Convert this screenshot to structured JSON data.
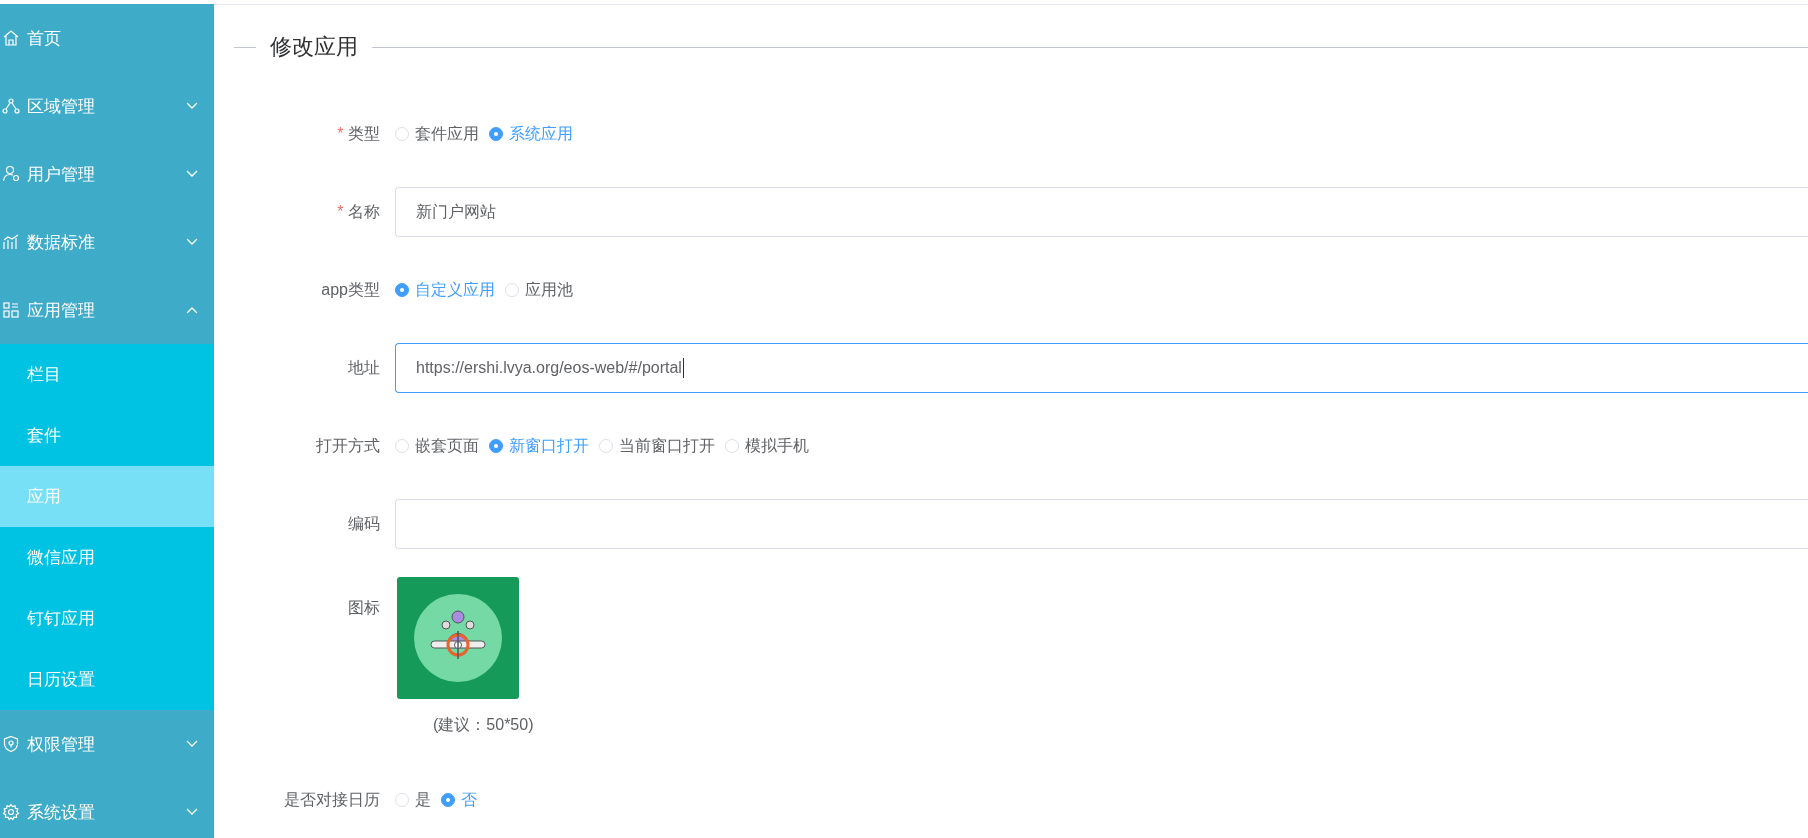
{
  "sidebar": {
    "items": [
      {
        "label": "首页",
        "kind": "link"
      },
      {
        "label": "区域管理",
        "kind": "group",
        "expanded": false
      },
      {
        "label": "用户管理",
        "kind": "group",
        "expanded": false
      },
      {
        "label": "数据标准",
        "kind": "group",
        "expanded": false
      },
      {
        "label": "应用管理",
        "kind": "group",
        "expanded": true,
        "children": [
          {
            "label": "栏目",
            "selected": false
          },
          {
            "label": "套件",
            "selected": false
          },
          {
            "label": "应用",
            "selected": true
          },
          {
            "label": "微信应用",
            "selected": false
          },
          {
            "label": "钉钉应用",
            "selected": false
          },
          {
            "label": "日历设置",
            "selected": false
          }
        ]
      },
      {
        "label": "权限管理",
        "kind": "group",
        "expanded": false
      },
      {
        "label": "系统设置",
        "kind": "group",
        "expanded": false
      }
    ]
  },
  "form": {
    "title": "修改应用",
    "fields": [
      {
        "kind": "radio",
        "label": "类型",
        "required_mark": "*",
        "options": [
          {
            "label": "套件应用",
            "selected": false
          },
          {
            "label": "系统应用",
            "selected": true
          }
        ]
      },
      {
        "kind": "text",
        "label": "名称",
        "required_mark": "*",
        "value": "新门户网站",
        "focused": false
      },
      {
        "kind": "radio",
        "label": "app类型",
        "options": [
          {
            "label": "自定义应用",
            "selected": true
          },
          {
            "label": "应用池",
            "selected": false
          }
        ]
      },
      {
        "kind": "text",
        "label": "地址",
        "value": "https://ershi.lvya.org/eos-web/#/portal",
        "focused": true
      },
      {
        "kind": "radio",
        "label": "打开方式",
        "options": [
          {
            "label": "嵌套页面",
            "selected": false
          },
          {
            "label": "新窗口打开",
            "selected": true
          },
          {
            "label": "当前窗口打开",
            "selected": false
          },
          {
            "label": "模拟手机",
            "selected": false
          }
        ]
      },
      {
        "kind": "text",
        "label": "编码",
        "focused": false
      },
      {
        "kind": "image",
        "label": "图标",
        "hint": "(建议：50*50)"
      },
      {
        "kind": "radio",
        "label": "是否对接日历",
        "options": [
          {
            "label": "是",
            "selected": false
          },
          {
            "label": "否",
            "selected": true
          }
        ]
      }
    ]
  }
}
